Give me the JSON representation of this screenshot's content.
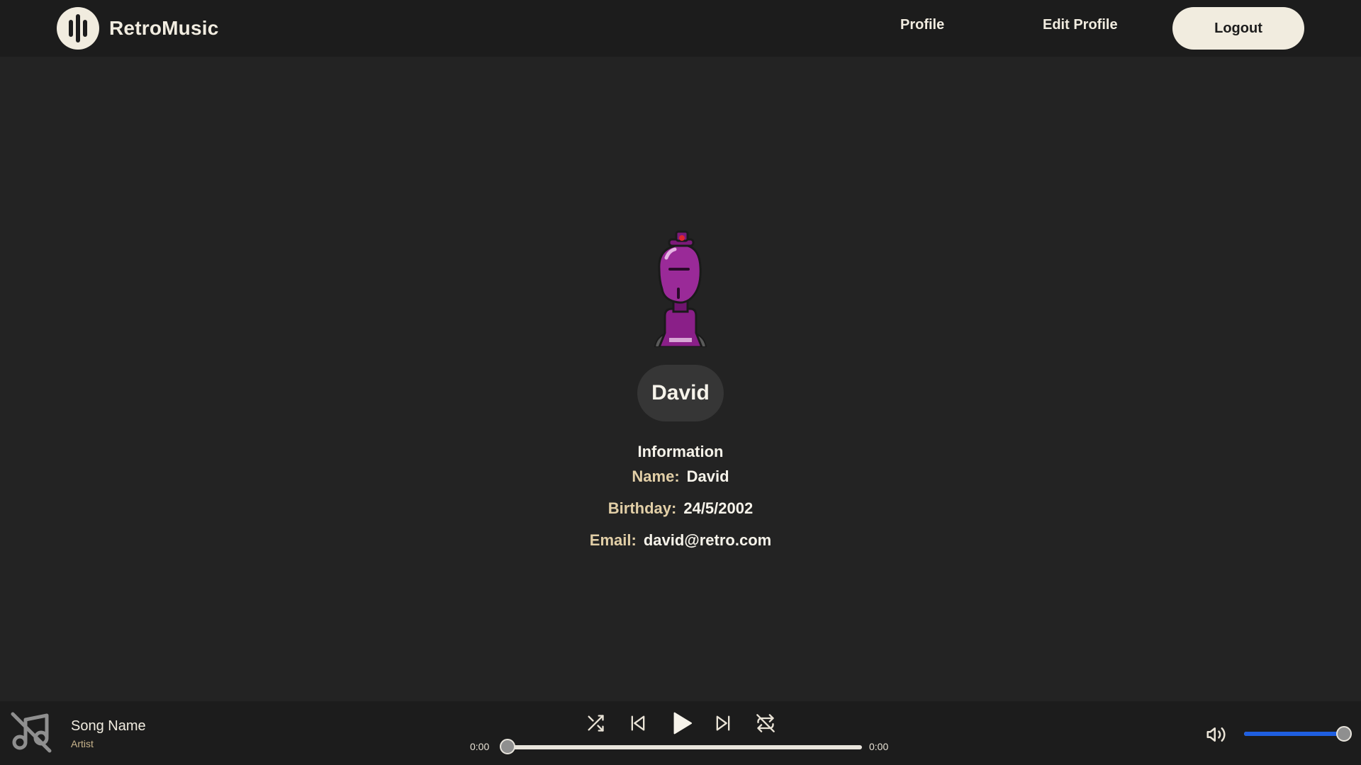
{
  "header": {
    "brand": "RetroMusic",
    "logo_icon": "sound-wave-icon",
    "nav": {
      "profile": "Profile",
      "edit_profile": "Edit Profile"
    },
    "logout_label": "Logout"
  },
  "profile": {
    "avatar_icon": "purple-robot-avatar",
    "display_name": "David",
    "info_title": "Information",
    "name_label": "Name:",
    "name_value": "David",
    "birthday_label": "Birthday:",
    "birthday_value": "24/5/2002",
    "email_label": "Email:",
    "email_value": "david@retro.com"
  },
  "player": {
    "cover_icon": "music-off-icon",
    "song_name": "Song Name",
    "artist": "Artist",
    "current_time": "0:00",
    "duration": "0:00",
    "progress": 0,
    "volume": 1.0,
    "controls": [
      "shuffle-icon",
      "previous-icon",
      "play-icon",
      "next-icon",
      "repeat-off-icon"
    ]
  },
  "colors": {
    "background": "#232323",
    "bar": "#1c1c1c",
    "cream": "#f1ecdf",
    "label": "#e2cfa7",
    "accent_blue": "#1f5fe0"
  }
}
